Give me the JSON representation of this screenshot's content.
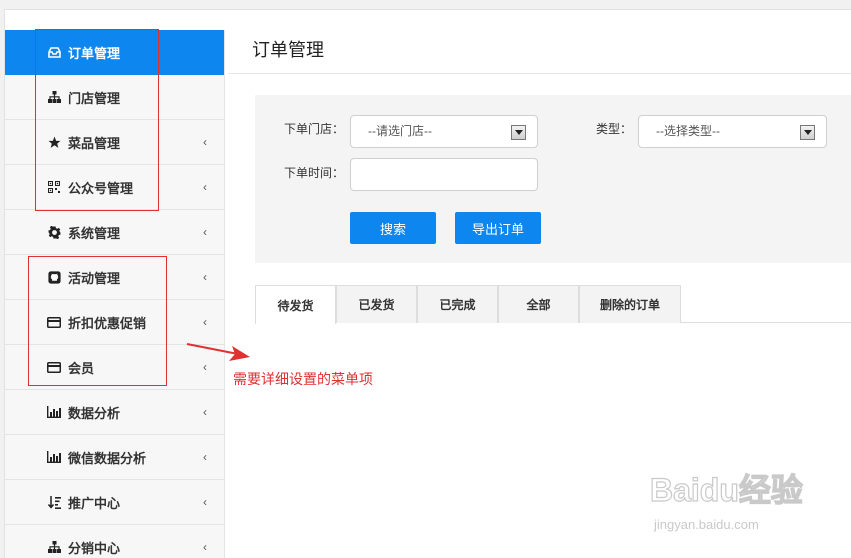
{
  "sidebar": {
    "items": [
      {
        "label": "订单管理",
        "icon": "inbox-icon",
        "chevron": ""
      },
      {
        "label": "门店管理",
        "icon": "sitemap-icon",
        "chevron": ""
      },
      {
        "label": "菜品管理",
        "icon": "star-icon",
        "chevron": "‹"
      },
      {
        "label": "公众号管理",
        "icon": "qrcode-icon",
        "chevron": "‹"
      },
      {
        "label": "系统管理",
        "icon": "gear-icon",
        "chevron": "‹"
      },
      {
        "label": "活动管理",
        "icon": "github-icon",
        "chevron": "‹"
      },
      {
        "label": "折扣优惠促销",
        "icon": "credit-card-icon",
        "chevron": "‹"
      },
      {
        "label": "会员",
        "icon": "credit-card-icon",
        "chevron": "‹"
      },
      {
        "label": "数据分析",
        "icon": "bar-chart-icon",
        "chevron": "‹"
      },
      {
        "label": "微信数据分析",
        "icon": "bar-chart-icon",
        "chevron": "‹"
      },
      {
        "label": "推广中心",
        "icon": "sort-icon",
        "chevron": "‹"
      },
      {
        "label": "分销中心",
        "icon": "sitemap-icon",
        "chevron": "‹"
      }
    ]
  },
  "main": {
    "title": "订单管理",
    "filters": {
      "store_label": "下单门店：",
      "store_value": "--请选门店--",
      "type_label": "类型：",
      "type_value": "--选择类型--",
      "time_label": "下单时间：",
      "time_value": ""
    },
    "buttons": {
      "search": "搜索",
      "export": "导出订单"
    },
    "tabs": [
      "待发货",
      "已发货",
      "已完成",
      "全部",
      "删除的订单"
    ]
  },
  "annotation": {
    "text": "需要详细设置的菜单项",
    "color": "#e03030"
  },
  "watermark": {
    "main": "Baidu经验",
    "sub": "jingyan.baidu.com"
  },
  "colors": {
    "accent": "#0e86f0"
  }
}
